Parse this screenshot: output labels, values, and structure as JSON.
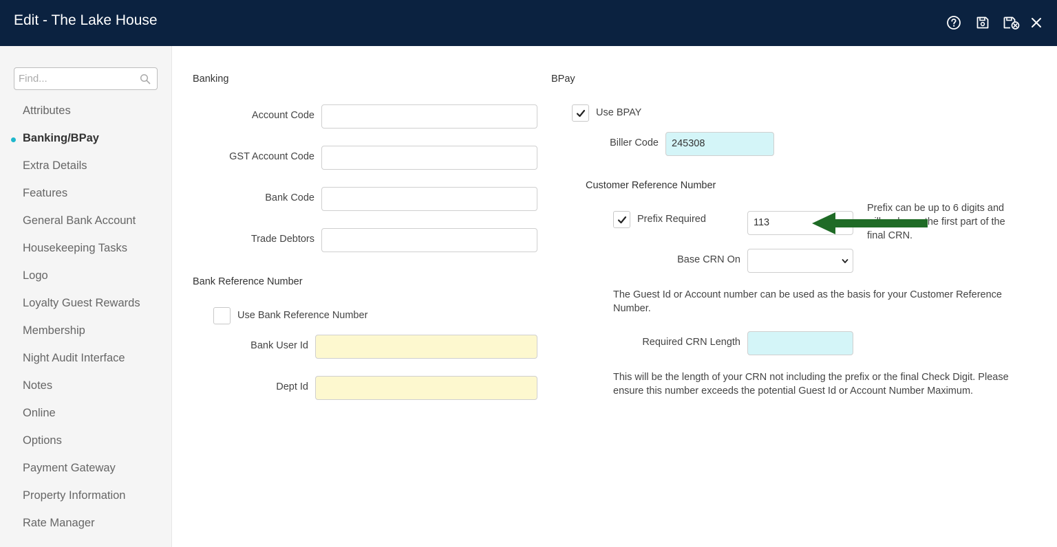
{
  "window": {
    "title": "Edit - The Lake House",
    "toolbar": {
      "help_icon": "question-circle-icon",
      "save_icon": "floppy-disk-icon",
      "save_close_icon": "floppy-disk-close-icon",
      "close_icon": "close-icon"
    }
  },
  "sidebar": {
    "search": {
      "placeholder": "Find...",
      "value": ""
    },
    "items": [
      {
        "label": "Attributes"
      },
      {
        "label": "Banking/BPay"
      },
      {
        "label": "Extra Details"
      },
      {
        "label": "Features"
      },
      {
        "label": "General Bank Account"
      },
      {
        "label": "Housekeeping Tasks"
      },
      {
        "label": "Logo"
      },
      {
        "label": "Loyalty Guest Rewards"
      },
      {
        "label": "Membership"
      },
      {
        "label": "Night Audit Interface"
      },
      {
        "label": "Notes"
      },
      {
        "label": "Online"
      },
      {
        "label": "Options"
      },
      {
        "label": "Payment Gateway"
      },
      {
        "label": "Property Information"
      },
      {
        "label": "Rate Manager"
      }
    ],
    "active_item": "Banking/BPay"
  },
  "banking": {
    "title": "Banking",
    "account_code": {
      "label": "Account Code",
      "value": ""
    },
    "gst_account_code": {
      "label": "GST Account Code",
      "value": ""
    },
    "bank_code": {
      "label": "Bank Code",
      "value": ""
    },
    "trade_debtors": {
      "label": "Trade Debtors",
      "value": ""
    }
  },
  "bank_reference": {
    "title": "Bank Reference Number",
    "use_bank_reference": {
      "label": "Use Bank Reference Number",
      "checked": false
    },
    "bank_user_id": {
      "label": "Bank User Id",
      "value": ""
    },
    "dept_id": {
      "label": "Dept Id",
      "value": ""
    }
  },
  "bpay": {
    "title": "BPay",
    "use_bpay": {
      "label": "Use BPAY",
      "checked": true
    },
    "biller_code": {
      "label": "Biller Code",
      "value": "245308"
    }
  },
  "crn": {
    "title": "Customer Reference Number",
    "prefix_required": {
      "label": "Prefix Required",
      "checked": true
    },
    "prefix_value": "113",
    "prefix_help_line1": "Prefix can be up to 6 digits and",
    "prefix_help_line2": "will make up the first part of the",
    "prefix_help_line3": "final CRN.",
    "base_crn_on": {
      "label": "Base CRN On",
      "value": ""
    },
    "base_crn_help": "The Guest Id or Account number can be used as the basis for your Customer Reference Number.",
    "required_length": {
      "label": "Required CRN Length",
      "value": ""
    },
    "length_help": "This will be the length of your CRN not including the prefix or the final Check Digit. Please ensure this number exceeds the potential Guest Id or Account Number Maximum."
  },
  "annotation": {
    "arrow_color": "#1f6b26"
  }
}
